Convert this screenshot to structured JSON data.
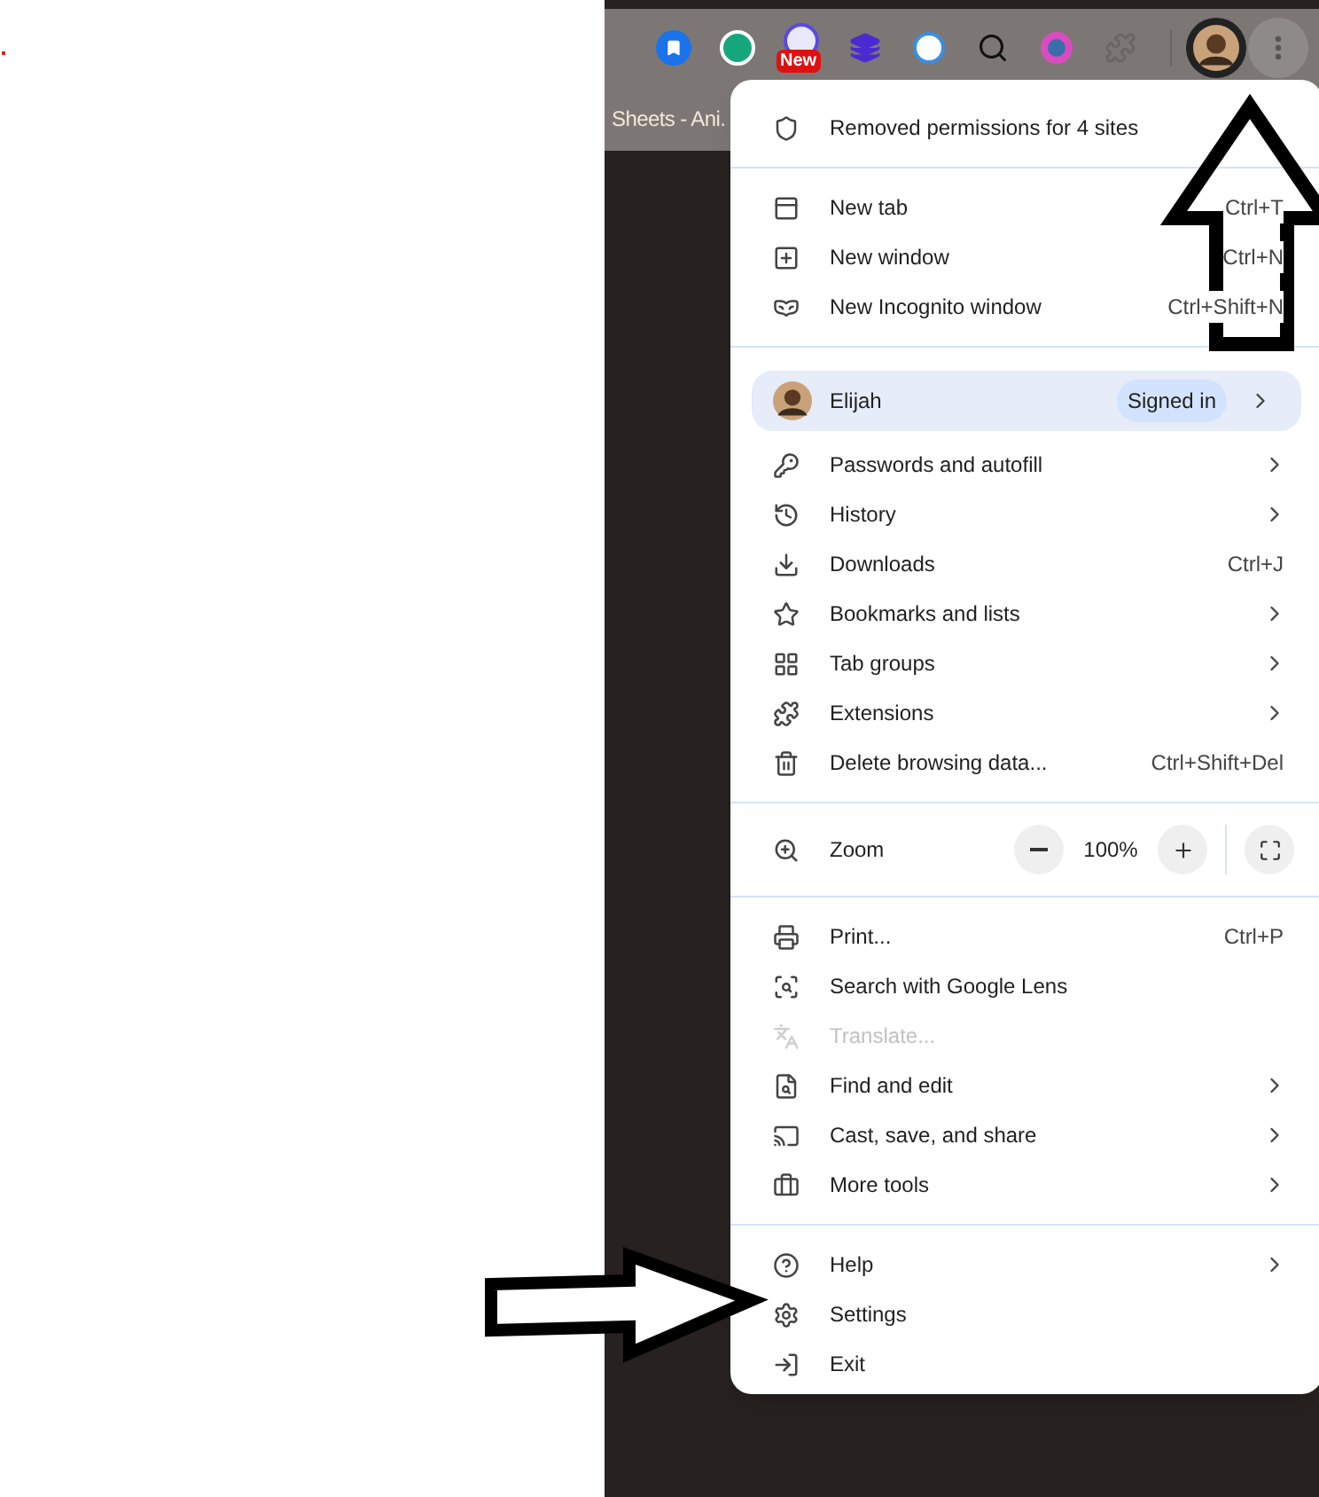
{
  "toolbar": {
    "badge": "New"
  },
  "bookmarks_bar": {
    "items": [
      "Sheets - Ani."
    ]
  },
  "menu": {
    "sections": [
      {
        "items": [
          {
            "kind": "item",
            "label": "Removed permissions for 4 sites",
            "submenu": false,
            "disabled": false
          }
        ]
      },
      {
        "items": [
          {
            "kind": "item",
            "label": "New tab",
            "shortcut": "Ctrl+T",
            "submenu": false,
            "disabled": false
          },
          {
            "kind": "item",
            "label": "New window",
            "shortcut": "Ctrl+N",
            "submenu": false,
            "disabled": false
          },
          {
            "kind": "item",
            "label": "New Incognito window",
            "shortcut": "Ctrl+Shift+N",
            "submenu": false,
            "disabled": false
          }
        ]
      },
      {
        "items": [
          {
            "kind": "profile",
            "label": "Elijah",
            "badge": "Signed in",
            "submenu": true
          },
          {
            "kind": "item",
            "label": "Passwords and autofill",
            "submenu": true,
            "disabled": false
          },
          {
            "kind": "item",
            "label": "History",
            "submenu": true,
            "disabled": false
          },
          {
            "kind": "item",
            "label": "Downloads",
            "shortcut": "Ctrl+J",
            "submenu": false,
            "disabled": false
          },
          {
            "kind": "item",
            "label": "Bookmarks and lists",
            "submenu": true,
            "disabled": false
          },
          {
            "kind": "item",
            "label": "Tab groups",
            "submenu": true,
            "disabled": false
          },
          {
            "kind": "item",
            "label": "Extensions",
            "submenu": true,
            "disabled": false
          },
          {
            "kind": "item",
            "label": "Delete browsing data...",
            "shortcut": "Ctrl+Shift+Del",
            "submenu": false,
            "disabled": false
          }
        ]
      },
      {
        "items": [
          {
            "kind": "zoom",
            "label": "Zoom",
            "value": "100%"
          }
        ]
      },
      {
        "items": [
          {
            "kind": "item",
            "label": "Print...",
            "shortcut": "Ctrl+P",
            "submenu": false,
            "disabled": false
          },
          {
            "kind": "item",
            "label": "Search with Google Lens",
            "submenu": false,
            "disabled": false
          },
          {
            "kind": "item",
            "label": "Translate...",
            "submenu": false,
            "disabled": true
          },
          {
            "kind": "item",
            "label": "Find and edit",
            "submenu": true,
            "disabled": false
          },
          {
            "kind": "item",
            "label": "Cast, save, and share",
            "submenu": true,
            "disabled": false
          },
          {
            "kind": "item",
            "label": "More tools",
            "submenu": true,
            "disabled": false
          }
        ]
      },
      {
        "items": [
          {
            "kind": "item",
            "label": "Help",
            "submenu": true,
            "disabled": false
          },
          {
            "kind": "item",
            "label": "Settings",
            "submenu": false,
            "disabled": false
          },
          {
            "kind": "item",
            "label": "Exit",
            "submenu": false,
            "disabled": false
          }
        ]
      }
    ]
  }
}
